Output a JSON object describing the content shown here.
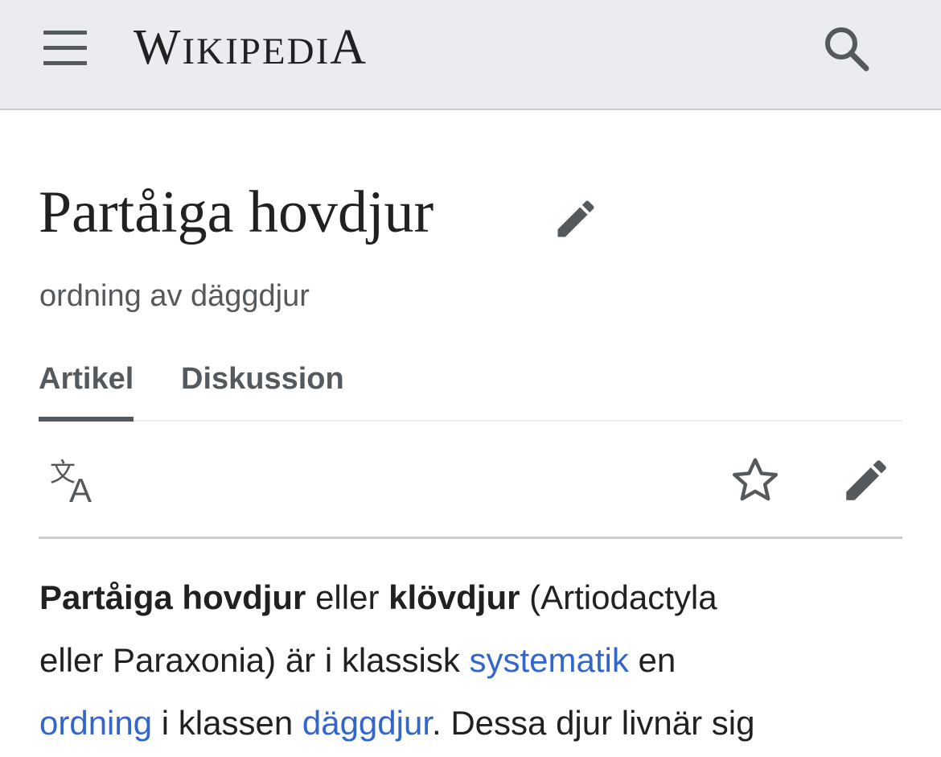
{
  "header": {
    "logo_initial": "W",
    "logo_middle": "IKIPEDI",
    "logo_final": "A",
    "icons": {
      "menu": "hamburger-icon",
      "search": "search-icon"
    }
  },
  "article": {
    "title": "Partåiga hovdjur",
    "subtitle": "ordning av däggdjur"
  },
  "tabs": [
    {
      "label": "Artikel",
      "active": true
    },
    {
      "label": "Diskussion",
      "active": false
    }
  ],
  "toolbar": {
    "icons": {
      "language": "translate-icon",
      "watch": "star-icon",
      "edit": "pencil-icon"
    }
  },
  "content": {
    "l1_bold1": "Partåiga hovdjur",
    "l1_text1": " eller ",
    "l1_bold2": "klövdjur",
    "l1_text2": " (Artiodactyla",
    "l2_text1": "eller Paraxonia) är i klassisk ",
    "l2_link1": "systematik",
    "l2_text2": " en",
    "l3_link1": "ordning",
    "l3_text1": " i klassen ",
    "l3_link2": "däggdjur",
    "l3_text2": ". Dessa djur livnär sig"
  },
  "colors": {
    "link": "#3366cc",
    "text": "#202122",
    "muted": "#54595d",
    "header_bg": "#eaecf0"
  }
}
